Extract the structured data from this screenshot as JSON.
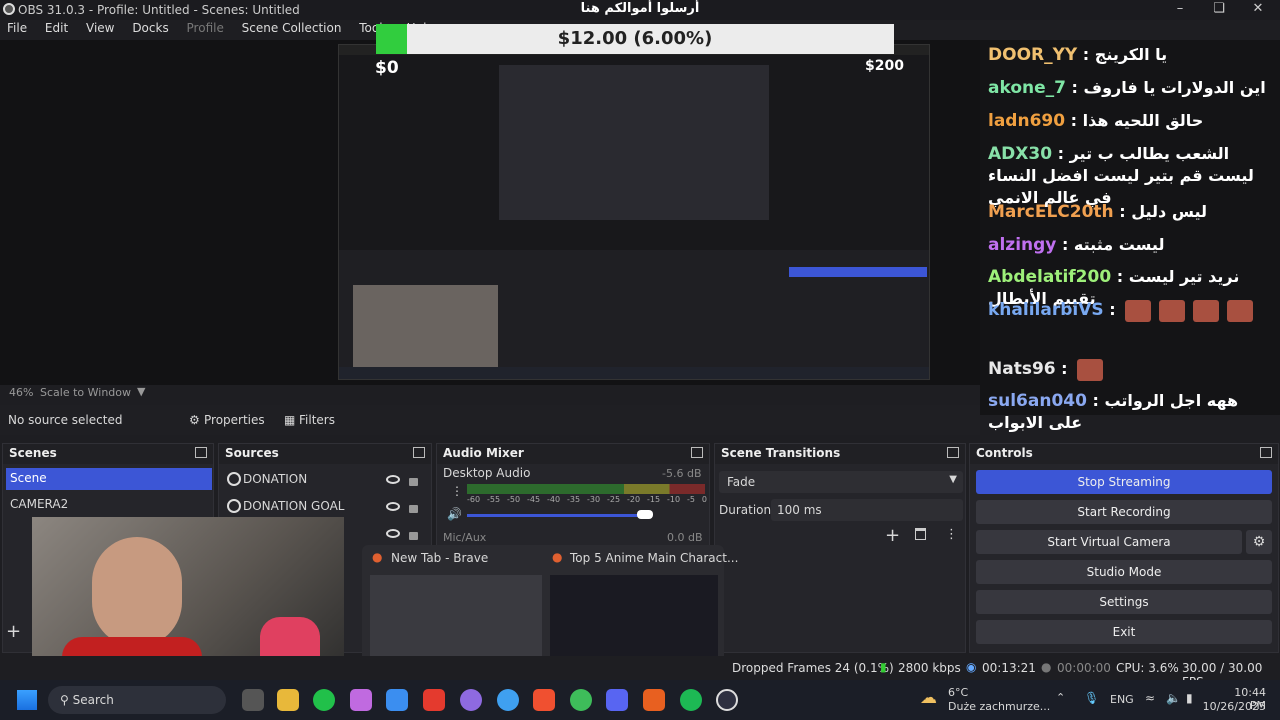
{
  "window": {
    "title": "OBS 31.0.3 - Profile: Untitled - Scenes: Untitled"
  },
  "menu": [
    "File",
    "Edit",
    "View",
    "Docks",
    "Profile",
    "Scene Collection",
    "Tools",
    "Help"
  ],
  "donation": {
    "title": "أرسلوا أموالكم هنا",
    "amount_text": "$12.00 (6.00%)",
    "progress_percent": 6,
    "min_label": "$0",
    "max_label": "$200"
  },
  "chat": [
    {
      "name": "DOOR_YY",
      "name_color": "#f0c070",
      "text": "يا الكرينج"
    },
    {
      "name": "akone_7",
      "name_color": "#7fe6a5",
      "text": "اين الدولارات يا فاروف"
    },
    {
      "name": "ladn690",
      "name_color": "#f0a040",
      "text": "حالق اللحيه هذا"
    },
    {
      "name": "ADX30",
      "name_color": "#88e0a8",
      "text": "الشعب يطالب ب تير ليست قم بتير ليست افضل النساء في عالم الانمي"
    },
    {
      "name": "MarcELC20th",
      "name_color": "#f0a050",
      "text": "ليس دليل"
    },
    {
      "name": "alzingy",
      "name_color": "#c070f0",
      "text": "ليست مثبته"
    },
    {
      "name": "Abdelatif200",
      "name_color": "#9ef07a",
      "text": "نريد تير ليست تقييم الأبطال"
    },
    {
      "name": "khalilarbiVS",
      "name_color": "#78a8f0",
      "text": ""
    },
    {
      "name": "Nats96",
      "name_color": "#e8e8e8",
      "text": ""
    },
    {
      "name": "sul6an040",
      "name_color": "#8aa8f0",
      "text": "ههه اجل الرواتب على الابواب"
    }
  ],
  "preview": {
    "zoom": "46%",
    "scale_mode": "Scale to Window"
  },
  "source_bar": {
    "status": "No source selected",
    "properties": "Properties",
    "filters": "Filters"
  },
  "scenes": {
    "title": "Scenes",
    "items": [
      "Scene",
      "CAMERA2"
    ]
  },
  "sources": {
    "title": "Sources",
    "items": [
      "DONATION",
      "DONATION GOAL"
    ]
  },
  "mixer": {
    "title": "Audio Mixer",
    "track1": "Desktop Audio",
    "track1_db": "-5.6 dB",
    "track2": "Mic/Aux",
    "track2_db": "0.0 dB",
    "scale": [
      "-60",
      "-55",
      "-50",
      "-45",
      "-40",
      "-35",
      "-30",
      "-25",
      "-20",
      "-15",
      "-10",
      "-5",
      "0"
    ]
  },
  "transitions": {
    "title": "Scene Transitions",
    "selected": "Fade",
    "duration_label": "Duration",
    "duration_value": "100 ms"
  },
  "controls": {
    "title": "Controls",
    "stop_streaming": "Stop Streaming",
    "start_recording": "Start Recording",
    "start_virtual_camera": "Start Virtual Camera",
    "studio_mode": "Studio Mode",
    "settings": "Settings",
    "exit": "Exit"
  },
  "task_preview": {
    "brave_tab": "New Tab - Brave",
    "anime_tab": "Top 5 Anime Main Charact..."
  },
  "status": {
    "dropped_frames": "Dropped Frames 24 (0.1%)",
    "bitrate": "2800 kbps",
    "stream_time": "00:13:21",
    "rec_time": "00:00:00",
    "cpu": "CPU: 3.6%",
    "fps": "30.00 / 30.00 FPS"
  },
  "taskbar": {
    "search": "Search",
    "weather_temp": "6°C",
    "weather_desc": "Duże zachmurze...",
    "lang": "ENG",
    "time": "10:44 PM",
    "date": "10/26/2025"
  },
  "colors": {
    "accent": "#3c56d6",
    "progress": "#31cd3e"
  }
}
